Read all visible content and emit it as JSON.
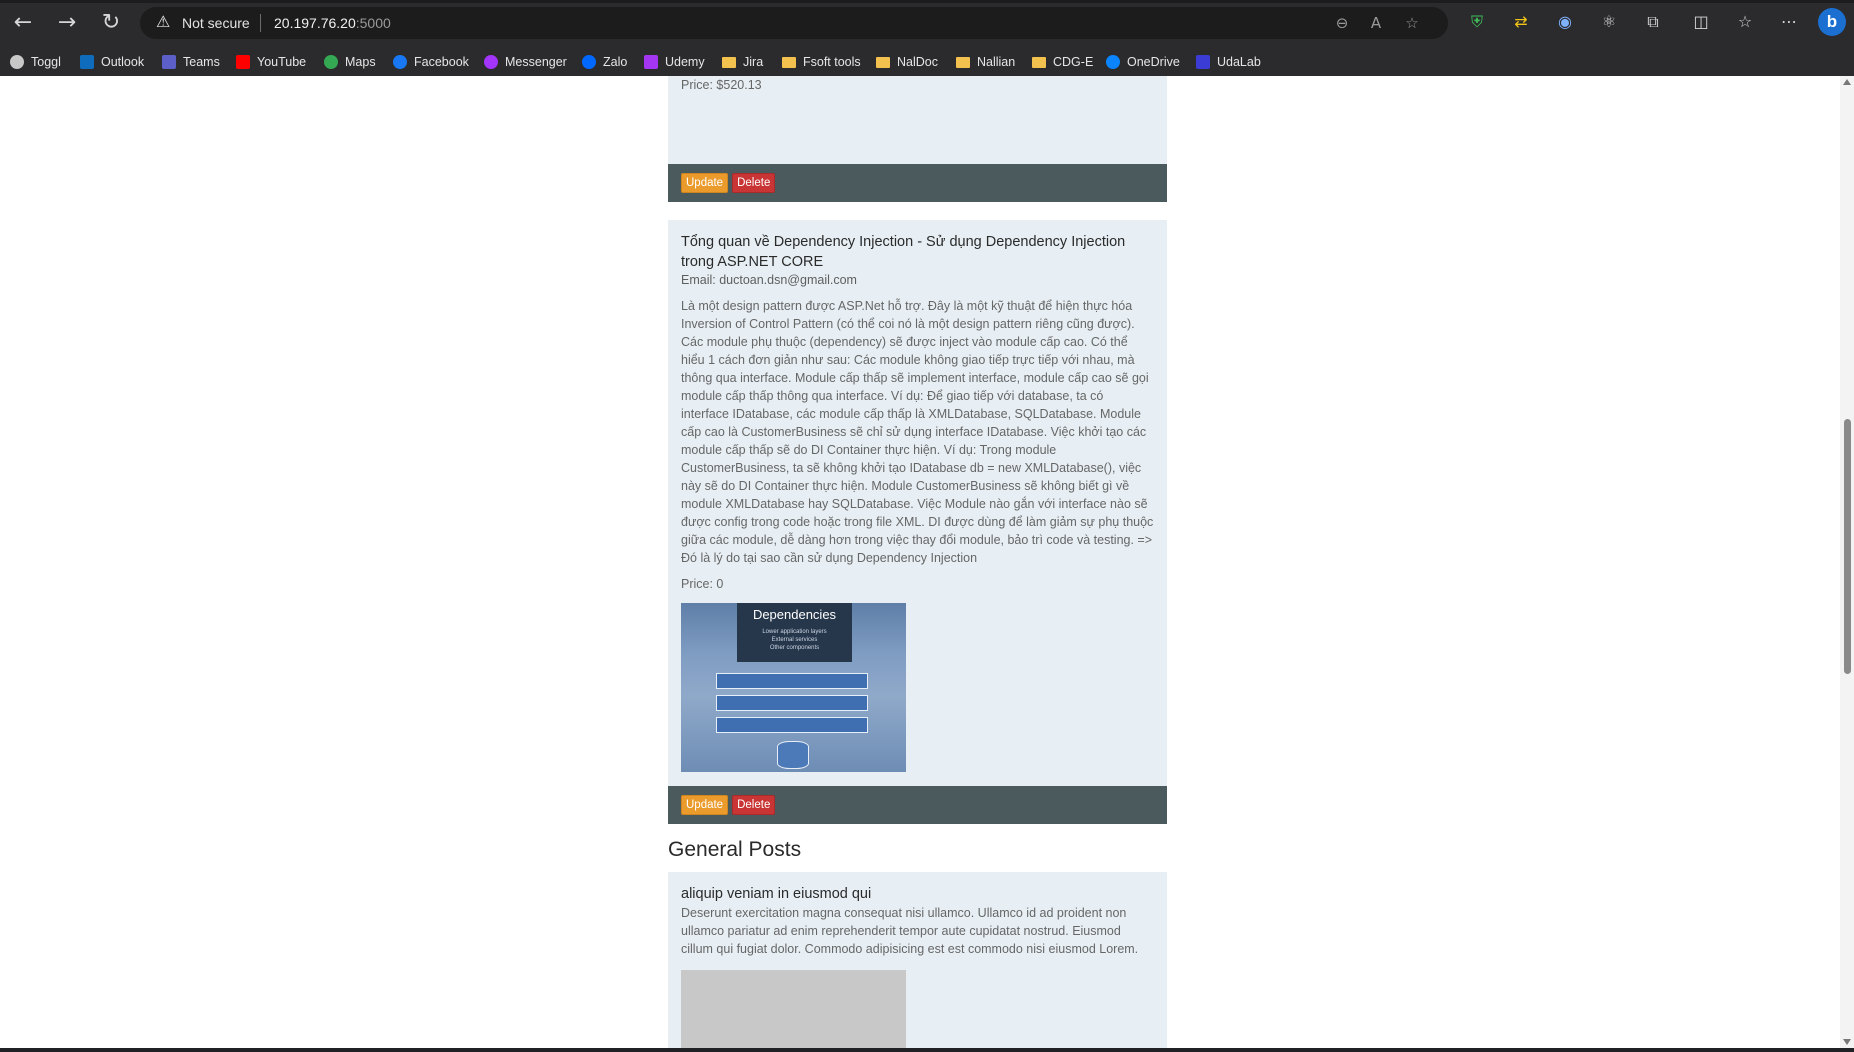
{
  "browser": {
    "not_secure": "Not secure",
    "url_host": "20.197.76.20",
    "url_port": ":5000",
    "bookmarks": [
      {
        "label": "Toggl",
        "icon": "toggl-icon",
        "color": "#c8c8c8"
      },
      {
        "label": "Outlook",
        "icon": "outlook-icon",
        "color": "#0f6cbd"
      },
      {
        "label": "Teams",
        "icon": "teams-icon",
        "color": "#5b5fc7"
      },
      {
        "label": "YouTube",
        "icon": "youtube-icon",
        "color": "#ff0000"
      },
      {
        "label": "Maps",
        "icon": "maps-icon",
        "color": "#34a853"
      },
      {
        "label": "Facebook",
        "icon": "facebook-icon",
        "color": "#1877f2"
      },
      {
        "label": "Messenger",
        "icon": "messenger-icon",
        "color": "#a334fa"
      },
      {
        "label": "Zalo",
        "icon": "zalo-icon",
        "color": "#0068ff"
      },
      {
        "label": "Udemy",
        "icon": "udemy-icon",
        "color": "#a435f0"
      },
      {
        "label": "Jira",
        "icon": "folder-icon",
        "color": "#f2c14e"
      },
      {
        "label": "Fsoft tools",
        "icon": "folder-icon",
        "color": "#f2c14e"
      },
      {
        "label": "NalDoc",
        "icon": "folder-icon",
        "color": "#f2c14e"
      },
      {
        "label": "Nallian",
        "icon": "folder-icon",
        "color": "#f2c14e"
      },
      {
        "label": "CDG-E",
        "icon": "folder-icon",
        "color": "#f2c14e"
      },
      {
        "label": "OneDrive",
        "icon": "onedrive-icon",
        "color": "#0a84ff"
      },
      {
        "label": "UdaLab",
        "icon": "udalab-icon",
        "color": "#3b3bd6"
      }
    ]
  },
  "page": {
    "top_card": {
      "price": "Price: $520.13",
      "update_label": "Update",
      "delete_label": "Delete"
    },
    "di_card": {
      "title": "Tổng quan về Dependency Injection - Sử dụng Dependency Injection trong ASP.NET CORE",
      "email": "Email: ductoan.dsn@gmail.com",
      "description": "Là một design pattern được ASP.Net hỗ trợ. Đây là một kỹ thuật để hiện thực hóa Inversion of Control Pattern (có thể coi nó là một design pattern riêng cũng được). Các module phụ thuộc (dependency) sẽ được inject vào module cấp cao. Có thể hiểu 1 cách đơn giản như sau: Các module không giao tiếp trực tiếp với nhau, mà thông qua interface. Module cấp thấp sẽ implement interface, module cấp cao sẽ gọi module cấp thấp thông qua interface. Ví dụ: Để giao tiếp với database, ta có interface IDatabase, các module cấp thấp là XMLDatabase, SQLDatabase. Module cấp cao là CustomerBusiness sẽ chỉ sử dụng interface IDatabase. Việc khởi tạo các module cấp thấp sẽ do DI Container thực hiện. Ví dụ: Trong module CustomerBusiness, ta sẽ không khởi tạo IDatabase db = new XMLDatabase(), việc này sẽ do DI Container thực hiện. Module CustomerBusiness sẽ không biết gì về module XMLDatabase hay SQLDatabase. Việc Module nào gắn với interface nào sẽ được config trong code hoặc trong file XML. DI được dùng để làm giảm sự phụ thuộc giữa các module, dễ dàng hơn trong việc thay đổi module, bảo trì code và testing. => Đó là lý do tại sao cần sử dụng Dependency Injection",
      "price": "Price: 0",
      "image_heading": "Dependencies",
      "image_lines": [
        "Lower application layers",
        "External services",
        "Other components"
      ],
      "update_label": "Update",
      "delete_label": "Delete"
    },
    "general_heading": "General Posts",
    "general_card": {
      "title": "aliquip veniam in eiusmod qui",
      "description": "Deserunt exercitation magna consequat nisi ullamco. Ullamco id ad proident non ullamco pariatur ad enim reprehenderit tempor aute cupidatat nostrud. Eiusmod cillum qui fugiat dolor. Commodo adipisicing est est commodo nisi eiusmod Lorem."
    }
  }
}
